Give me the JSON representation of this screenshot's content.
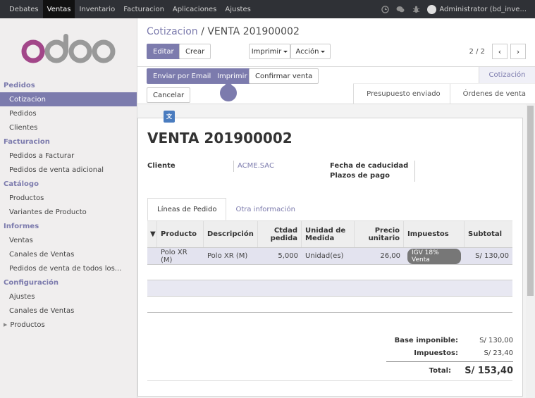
{
  "topbar": {
    "menu": [
      "Debates",
      "Ventas",
      "Inventario",
      "Facturacion",
      "Aplicaciones",
      "Ajustes"
    ],
    "active": "Ventas",
    "user": "Administrator (bd_inve..."
  },
  "sidebar": {
    "sections": [
      {
        "title": "Pedidos",
        "items": [
          "Cotizacion",
          "Pedidos",
          "Clientes"
        ]
      },
      {
        "title": "Facturacion",
        "items": [
          "Pedidos a Facturar",
          "Pedidos de venta adicional"
        ]
      },
      {
        "title": "Catálogo",
        "items": [
          "Productos",
          "Variantes de Producto"
        ]
      },
      {
        "title": "Informes",
        "items": [
          "Ventas",
          "Canales de Ventas",
          "Pedidos de venta de todos los..."
        ]
      },
      {
        "title": "Configuración",
        "items": [
          "Ajustes",
          "Canales de Ventas",
          "Productos"
        ]
      }
    ],
    "active_item": "Cotizacion"
  },
  "breadcrumb": {
    "parent": "Cotizacion",
    "separator": "/",
    "current": "VENTA 201900002"
  },
  "controls": {
    "edit": "Editar",
    "create": "Crear",
    "print": "Imprimir",
    "action": "Acción",
    "pager": "2 / 2",
    "prev": "‹",
    "next": "›"
  },
  "statusbar": {
    "send_email": "Enviar por Email",
    "print": "Imprimir",
    "confirm": "Confirmar venta",
    "cancel": "Cancelar",
    "active_stage": "Cotización",
    "stages": [
      "Presupuesto enviado",
      "Órdenes de venta"
    ]
  },
  "form": {
    "title": "VENTA 201900002",
    "customer_label": "Cliente",
    "customer_value": "ACME.SAC",
    "expiry_label": "Fecha de caducidad",
    "terms_label": "Plazos de pago",
    "tabs": [
      "Líneas de Pedido",
      "Otra información"
    ],
    "columns": [
      "Producto",
      "Descripción",
      "Ctdad pedida",
      "Unidad de Medida",
      "Precio unitario",
      "Impuestos",
      "Subtotal"
    ],
    "rows": [
      {
        "product": "Polo XR (M)",
        "description": "Polo XR (M)",
        "qty": "5,000",
        "uom": "Unidad(es)",
        "price": "26,00",
        "tax": "IGV 18% Venta",
        "subtotal": "S/ 130,00"
      }
    ],
    "totals": {
      "base_label": "Base imponible:",
      "base_value": "S/ 130,00",
      "tax_label": "Impuestos:",
      "tax_value": "S/ 23,40",
      "total_label": "Total:",
      "total_value": "S/ 153,40"
    }
  },
  "colors": {
    "accent": "#7c7bad",
    "topbar": "#2f3136"
  }
}
